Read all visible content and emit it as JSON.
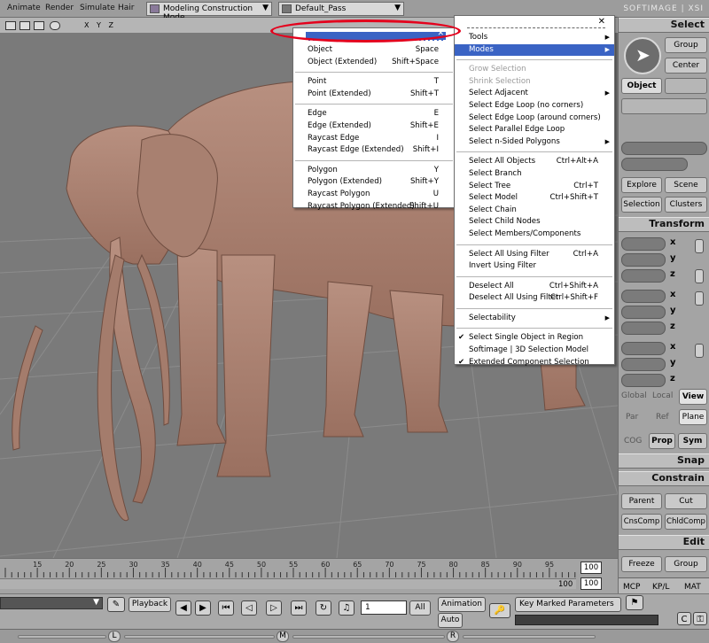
{
  "menubar": {
    "items": [
      "Animate",
      "Render",
      "Simulate",
      "Hair"
    ],
    "mode_combo": "Modeling Construction Mode",
    "pass_combo": "Default_Pass",
    "brand": "SOFTIMAGE | XSI"
  },
  "viewport_toolbar": {
    "axes": "X Y Z"
  },
  "menu_left": {
    "items": [
      {
        "label": "Object",
        "shortcut": "Space"
      },
      {
        "label": "Object (Extended)",
        "shortcut": "Shift+Space"
      },
      {
        "sep": true
      },
      {
        "label": "Point",
        "shortcut": "T"
      },
      {
        "label": "Point (Extended)",
        "shortcut": "Shift+T"
      },
      {
        "sep": true
      },
      {
        "label": "Edge",
        "shortcut": "E"
      },
      {
        "label": "Edge (Extended)",
        "shortcut": "Shift+E"
      },
      {
        "label": "Raycast Edge",
        "shortcut": "I"
      },
      {
        "label": "Raycast Edge (Extended)",
        "shortcut": "Shift+I"
      },
      {
        "sep": true
      },
      {
        "label": "Polygon",
        "shortcut": "Y"
      },
      {
        "label": "Polygon (Extended)",
        "shortcut": "Shift+Y"
      },
      {
        "label": "Raycast Polygon",
        "shortcut": "U"
      },
      {
        "label": "Raycast Polygon (Extended)",
        "shortcut": "Shift+U"
      }
    ]
  },
  "menu_right": {
    "items": [
      {
        "label": "Tools",
        "submenu": true
      },
      {
        "label": "Modes",
        "submenu": true,
        "selected": true
      },
      {
        "sep": true
      },
      {
        "label": "Grow Selection",
        "disabled": true
      },
      {
        "label": "Shrink Selection",
        "disabled": true
      },
      {
        "label": "Select Adjacent",
        "submenu": true
      },
      {
        "label": "Select Edge Loop (no corners)"
      },
      {
        "label": "Select Edge Loop (around corners)"
      },
      {
        "label": "Select Parallel Edge Loop"
      },
      {
        "label": "Select n-Sided Polygons",
        "submenu": true
      },
      {
        "sep": true
      },
      {
        "label": "Select All Objects",
        "shortcut": "Ctrl+Alt+A"
      },
      {
        "label": "Select Branch"
      },
      {
        "label": "Select Tree",
        "shortcut": "Ctrl+T"
      },
      {
        "label": "Select Model",
        "shortcut": "Ctrl+Shift+T"
      },
      {
        "label": "Select Chain"
      },
      {
        "label": "Select Child Nodes"
      },
      {
        "label": "Select Members/Components"
      },
      {
        "sep": true
      },
      {
        "label": "Select All Using Filter",
        "shortcut": "Ctrl+A"
      },
      {
        "label": "Invert Using Filter"
      },
      {
        "sep": true
      },
      {
        "label": "Deselect All",
        "shortcut": "Ctrl+Shift+A"
      },
      {
        "label": "Deselect All Using Filter",
        "shortcut": "Ctrl+Shift+F"
      },
      {
        "sep": true
      },
      {
        "label": "Selectability",
        "submenu": true
      },
      {
        "sep": true
      },
      {
        "label": "Select Single Object in Region",
        "checked": true
      },
      {
        "label": "Softimage | 3D Selection Model"
      },
      {
        "label": "Extended Component Selection",
        "checked": true
      }
    ]
  },
  "right_panel": {
    "select_header": "Select",
    "group": "Group",
    "center": "Center",
    "object": "Object",
    "explore": "Explore",
    "scene": "Scene",
    "selection": "Selection",
    "clusters": "Clusters",
    "transform_header": "Transform",
    "axes": [
      "x",
      "y",
      "z"
    ],
    "global": "Global",
    "local": "Local",
    "view": "View",
    "par": "Par",
    "ref": "Ref",
    "plane": "Plane",
    "cog": "COG",
    "prop": "Prop",
    "sym": "Sym",
    "snap_header": "Snap",
    "constrain_header": "Constrain",
    "parent": "Parent",
    "cut": "Cut",
    "cnscomp": "CnsComp",
    "chldcomp": "ChldComp",
    "edit_header": "Edit",
    "freeze": "Freeze",
    "group2": "Group",
    "tabs": [
      "MCP",
      "KP/L",
      "MAT"
    ]
  },
  "timeline": {
    "ticks": [
      "15",
      "20",
      "25",
      "30",
      "35",
      "40",
      "45",
      "50",
      "55",
      "60",
      "65",
      "70",
      "75",
      "80",
      "85",
      "90",
      "95"
    ],
    "end_top": "100",
    "end_bottom": "100",
    "start_right": "100"
  },
  "bottombar": {
    "playback": "Playback",
    "frame": "1",
    "all": "All",
    "animation": "Animation",
    "auto": "Auto",
    "key_marked": "Key Marked Parameters"
  },
  "mouse_hints": {
    "l": "L",
    "m": "M",
    "r": "R"
  },
  "colors": {
    "model": "#b08877",
    "highlight": "#e4001c",
    "menu_select": "#3a63c4"
  }
}
